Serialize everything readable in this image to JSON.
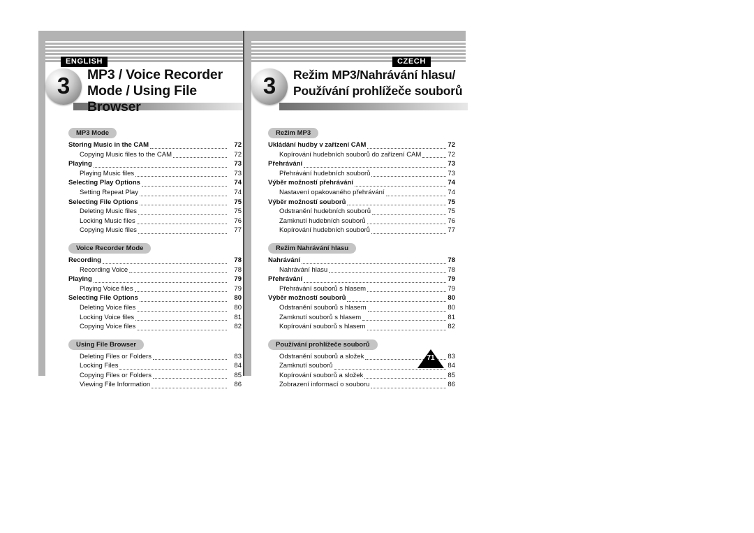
{
  "document": {
    "page_number_marker": "71"
  },
  "left_page": {
    "language_tag": "ENGLISH",
    "chapter_number": "3",
    "chapter_title_line1": "MP3 / Voice Recorder",
    "chapter_title_line2": "Mode / Using File Browser",
    "sections": [
      {
        "pill": "MP3 Mode",
        "entries": [
          {
            "level": 1,
            "title": "Storing Music in the CAM",
            "page": "72"
          },
          {
            "level": 2,
            "title": "Copying Music files to the CAM",
            "page": "72"
          },
          {
            "level": 1,
            "title": "Playing",
            "page": "73"
          },
          {
            "level": 2,
            "title": "Playing Music files",
            "page": "73"
          },
          {
            "level": 1,
            "title": "Selecting Play Options",
            "page": "74"
          },
          {
            "level": 2,
            "title": "Setting Repeat Play",
            "page": "74"
          },
          {
            "level": 1,
            "title": "Selecting File Options",
            "page": "75"
          },
          {
            "level": 2,
            "title": "Deleting Music files",
            "page": "75"
          },
          {
            "level": 2,
            "title": "Locking Music files",
            "page": "76"
          },
          {
            "level": 2,
            "title": "Copying Music files",
            "page": "77"
          }
        ]
      },
      {
        "pill": "Voice Recorder Mode",
        "entries": [
          {
            "level": 1,
            "title": "Recording",
            "page": "78"
          },
          {
            "level": 2,
            "title": "Recording Voice",
            "page": "78"
          },
          {
            "level": 1,
            "title": "Playing",
            "page": "79"
          },
          {
            "level": 2,
            "title": "Playing Voice files",
            "page": "79"
          },
          {
            "level": 1,
            "title": "Selecting File Options",
            "page": "80"
          },
          {
            "level": 2,
            "title": "Deleting Voice files",
            "page": "80"
          },
          {
            "level": 2,
            "title": "Locking Voice files",
            "page": "81"
          },
          {
            "level": 2,
            "title": "Copying Voice files",
            "page": "82"
          }
        ]
      },
      {
        "pill": "Using File Browser",
        "entries": [
          {
            "level": 2,
            "title": "Deleting Files or Folders",
            "page": "83"
          },
          {
            "level": 2,
            "title": "Locking Files",
            "page": "84"
          },
          {
            "level": 2,
            "title": "Copying Files or Folders",
            "page": "85"
          },
          {
            "level": 2,
            "title": "Viewing File Information",
            "page": "86"
          }
        ]
      }
    ]
  },
  "right_page": {
    "language_tag": "CZECH",
    "chapter_number": "3",
    "chapter_title_line1": "Režim MP3/Nahrávání hlasu/",
    "chapter_title_line2": "Používání prohlížeče souborů",
    "sections": [
      {
        "pill": "Režim MP3",
        "entries": [
          {
            "level": 1,
            "title": "Ukládání hudby v zařízení CAM",
            "page": "72"
          },
          {
            "level": 2,
            "title": "Kopírování hudebních souborů do zařízení CAM",
            "page": "72"
          },
          {
            "level": 1,
            "title": "Přehrávání",
            "page": "73"
          },
          {
            "level": 2,
            "title": "Přehrávání hudebních souborů",
            "page": "73"
          },
          {
            "level": 1,
            "title": "Výběr možností přehrávání",
            "page": "74"
          },
          {
            "level": 2,
            "title": "Nastavení opakovaného přehrávání",
            "page": "74"
          },
          {
            "level": 1,
            "title": "Výběr možností souborů",
            "page": "75"
          },
          {
            "level": 2,
            "title": "Odstranění hudebních souborů",
            "page": "75"
          },
          {
            "level": 2,
            "title": "Zamknutí hudebních souborů",
            "page": "76"
          },
          {
            "level": 2,
            "title": "Kopírování hudebních souborů",
            "page": "77"
          }
        ]
      },
      {
        "pill": "Režim Nahrávání hlasu",
        "entries": [
          {
            "level": 1,
            "title": "Nahrávání",
            "page": "78"
          },
          {
            "level": 2,
            "title": "Nahrávání hlasu",
            "page": "78"
          },
          {
            "level": 1,
            "title": "Přehrávání",
            "page": "79"
          },
          {
            "level": 2,
            "title": "Přehrávání souborů s hlasem",
            "page": "79"
          },
          {
            "level": 1,
            "title": "Výběr možností souborů",
            "page": "80"
          },
          {
            "level": 2,
            "title": "Odstranění souborů s hlasem",
            "page": "80"
          },
          {
            "level": 2,
            "title": "Zamknutí souborů s hlasem",
            "page": "81"
          },
          {
            "level": 2,
            "title": "Kopírování souborů s hlasem",
            "page": "82"
          }
        ]
      },
      {
        "pill": "Používání prohlížeče souborů",
        "entries": [
          {
            "level": 2,
            "title": "Odstranění souborů a složek",
            "page": "83"
          },
          {
            "level": 2,
            "title": "Zamknutí souborů",
            "page": "84"
          },
          {
            "level": 2,
            "title": "Kopírování souborů a složek",
            "page": "85"
          },
          {
            "level": 2,
            "title": "Zobrazení informací o souboru",
            "page": "86"
          }
        ]
      }
    ]
  }
}
